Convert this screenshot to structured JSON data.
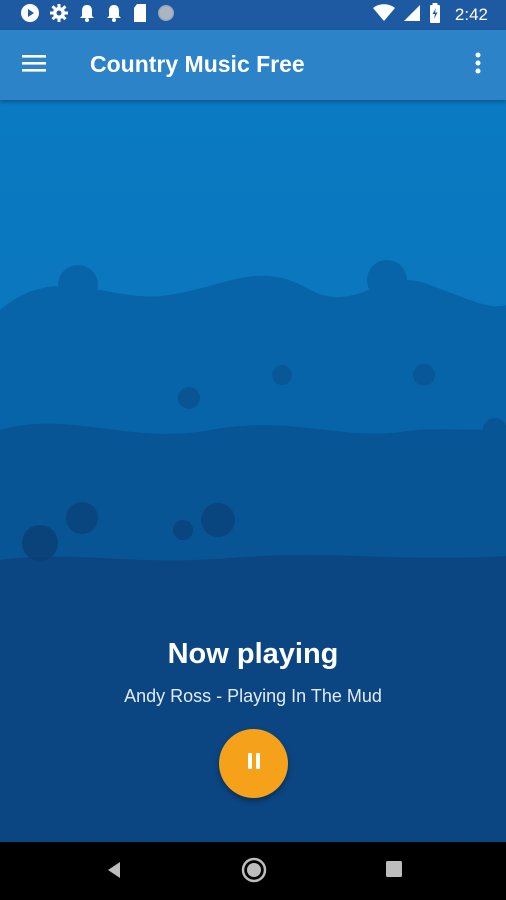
{
  "status_bar": {
    "time": "2:42",
    "left_icons": [
      "play-circle-icon",
      "settings-gear-icon",
      "notification-bell-icon",
      "notification-bell-icon",
      "sd-card-icon",
      "record-dot-icon"
    ],
    "right_icons": [
      "wifi-icon",
      "cell-signal-icon",
      "battery-icon"
    ]
  },
  "app_bar": {
    "title": "Country Music Free",
    "menu_icon": "hamburger-menu-icon",
    "overflow_icon": "more-vertical-icon"
  },
  "player": {
    "heading": "Now playing",
    "track": "Andy Ross - Playing In The Mud",
    "button_icon": "pause-icon",
    "accent_color": "#f6a11a"
  },
  "nav_bar": {
    "icons": [
      "back-triangle-icon",
      "home-circle-icon",
      "recents-square-icon"
    ]
  },
  "colors": {
    "status_bar": "#1d5aa1",
    "app_bar": "#2c83c7",
    "background_top": "#0a7ac2",
    "background_bottom": "#0b3f76"
  }
}
